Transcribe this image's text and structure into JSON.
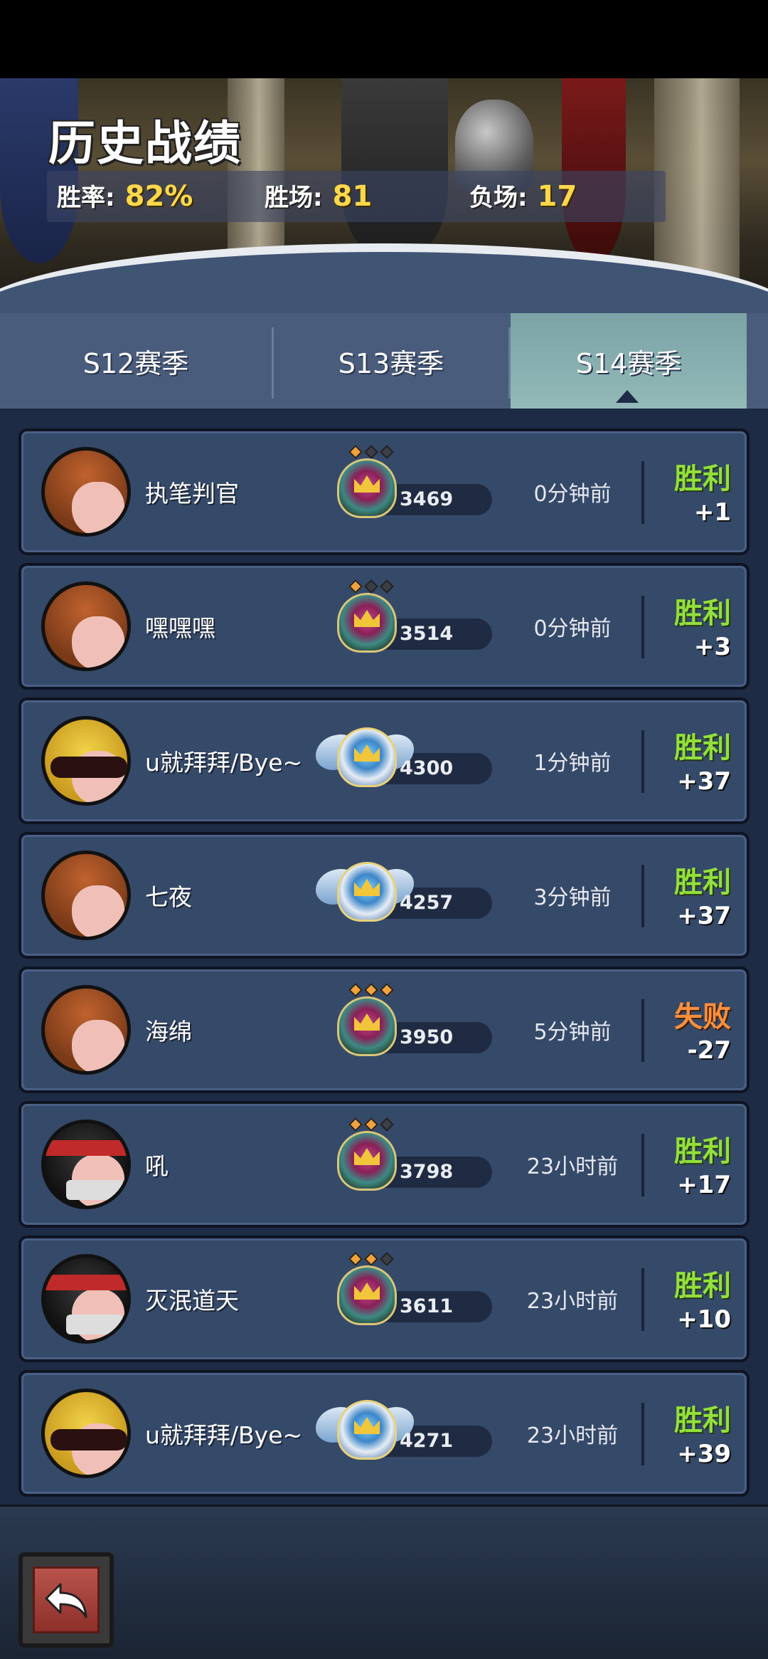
{
  "header": {
    "title": "历史战绩",
    "stats": {
      "win_rate_label": "胜率:",
      "win_rate_value": "82%",
      "wins_label": "胜场:",
      "wins_value": "81",
      "losses_label": "负场:",
      "losses_value": "17"
    }
  },
  "tabs": [
    {
      "label": "S12赛季",
      "selected": false
    },
    {
      "label": "S13赛季",
      "selected": false
    },
    {
      "label": "S14赛季",
      "selected": true
    }
  ],
  "matches": [
    {
      "name": "执笔判官",
      "avatar": "pumpkin-hood-icon",
      "rank_badge": "shield-badge-icon",
      "pips_on": 1,
      "score": "3469",
      "time": "0分钟前",
      "result": "胜利",
      "outcome": "win",
      "delta": "+1"
    },
    {
      "name": "嘿嘿嘿",
      "avatar": "pumpkin-hood-icon",
      "rank_badge": "shield-badge-icon",
      "pips_on": 1,
      "score": "3514",
      "time": "0分钟前",
      "result": "胜利",
      "outcome": "win",
      "delta": "+3"
    },
    {
      "name": "u就拜拜/Bye~",
      "avatar": "sunglasses-icon",
      "rank_badge": "winged-badge-icon",
      "pips_on": 0,
      "score": "4300",
      "time": "1分钟前",
      "result": "胜利",
      "outcome": "win",
      "delta": "+37"
    },
    {
      "name": "七夜",
      "avatar": "pumpkin-hood-icon",
      "rank_badge": "winged-badge-icon",
      "pips_on": 0,
      "score": "4257",
      "time": "3分钟前",
      "result": "胜利",
      "outcome": "win",
      "delta": "+37"
    },
    {
      "name": "海绵",
      "avatar": "pumpkin-hood-icon",
      "rank_badge": "shield-badge-icon",
      "pips_on": 3,
      "score": "3950",
      "time": "5分钟前",
      "result": "失败",
      "outcome": "loss",
      "delta": "-27"
    },
    {
      "name": "吼",
      "avatar": "ninja-mask-icon",
      "rank_badge": "shield-badge-icon",
      "pips_on": 2,
      "score": "3798",
      "time": "23小时前",
      "result": "胜利",
      "outcome": "win",
      "delta": "+17"
    },
    {
      "name": "灭泯道天",
      "avatar": "ninja-mask-icon",
      "rank_badge": "shield-badge-icon",
      "pips_on": 2,
      "score": "3611",
      "time": "23小时前",
      "result": "胜利",
      "outcome": "win",
      "delta": "+10"
    },
    {
      "name": "u就拜拜/Bye~",
      "avatar": "sunglasses-icon",
      "rank_badge": "winged-badge-icon",
      "pips_on": 0,
      "score": "4271",
      "time": "23小时前",
      "result": "胜利",
      "outcome": "win",
      "delta": "+39"
    }
  ],
  "colors": {
    "win": "#93e03a",
    "loss": "#ff8f3a",
    "stat_value": "#ffd84a",
    "row_bg": "#354969",
    "list_bg": "#1d2b44"
  },
  "bottom_bar": {
    "back_icon": "back-arrow-icon"
  }
}
